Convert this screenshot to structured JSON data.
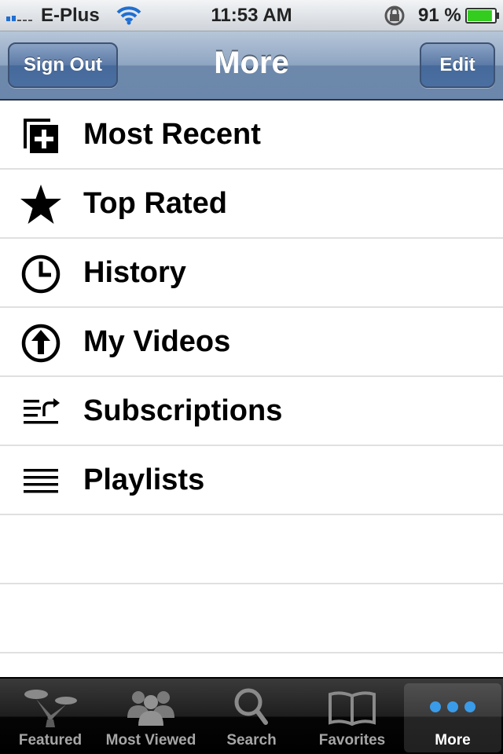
{
  "status_bar": {
    "carrier": "E-Plus",
    "time": "11:53 AM",
    "battery_percent": "91 %",
    "battery_level": 0.91,
    "battery_color": "#33cc1f"
  },
  "nav": {
    "title": "More",
    "left_button": "Sign Out",
    "right_button": "Edit"
  },
  "menu": {
    "items": [
      {
        "label": "Most Recent",
        "icon": "most-recent-icon"
      },
      {
        "label": "Top Rated",
        "icon": "star-icon"
      },
      {
        "label": "History",
        "icon": "clock-icon"
      },
      {
        "label": "My Videos",
        "icon": "upload-icon"
      },
      {
        "label": "Subscriptions",
        "icon": "subscriptions-icon"
      },
      {
        "label": "Playlists",
        "icon": "playlists-icon"
      }
    ]
  },
  "tab_bar": {
    "tabs": [
      {
        "label": "Featured",
        "icon": "featured-icon"
      },
      {
        "label": "Most Viewed",
        "icon": "most-viewed-icon"
      },
      {
        "label": "Search",
        "icon": "search-icon"
      },
      {
        "label": "Favorites",
        "icon": "favorites-icon"
      },
      {
        "label": "More",
        "icon": "more-icon"
      }
    ],
    "active": "More",
    "active_color": "#3a9be8"
  }
}
